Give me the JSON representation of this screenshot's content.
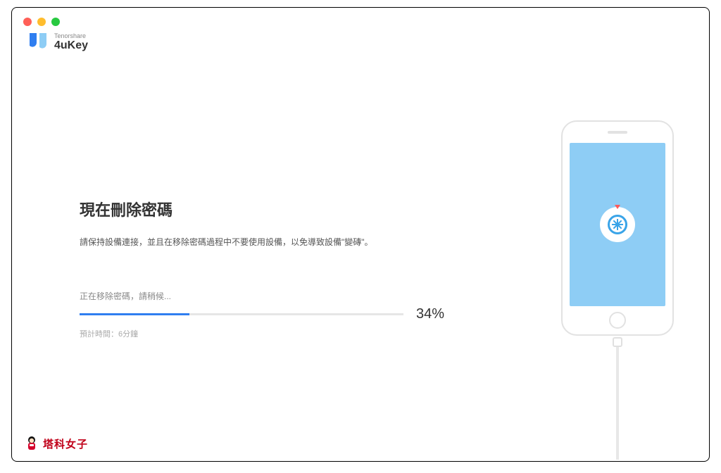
{
  "window": {
    "brand_small": "Tenorshare",
    "brand_name": "4uKey"
  },
  "main": {
    "title": "現在刪除密碼",
    "instruction": "請保持設備連接，並且在移除密碼過程中不要使用設備，以免導致設備\"變磚\"。",
    "status_label": "正在移除密碼，請稍候...",
    "progress_percent_text": "34%",
    "progress_percent_value": "34",
    "eta": "預計時間：6分鐘"
  },
  "footer": {
    "brand": "塔科女子"
  },
  "colors": {
    "accent": "#2f7ef0",
    "phone_screen": "#8ecdf5",
    "footer_brand": "#c00019"
  }
}
